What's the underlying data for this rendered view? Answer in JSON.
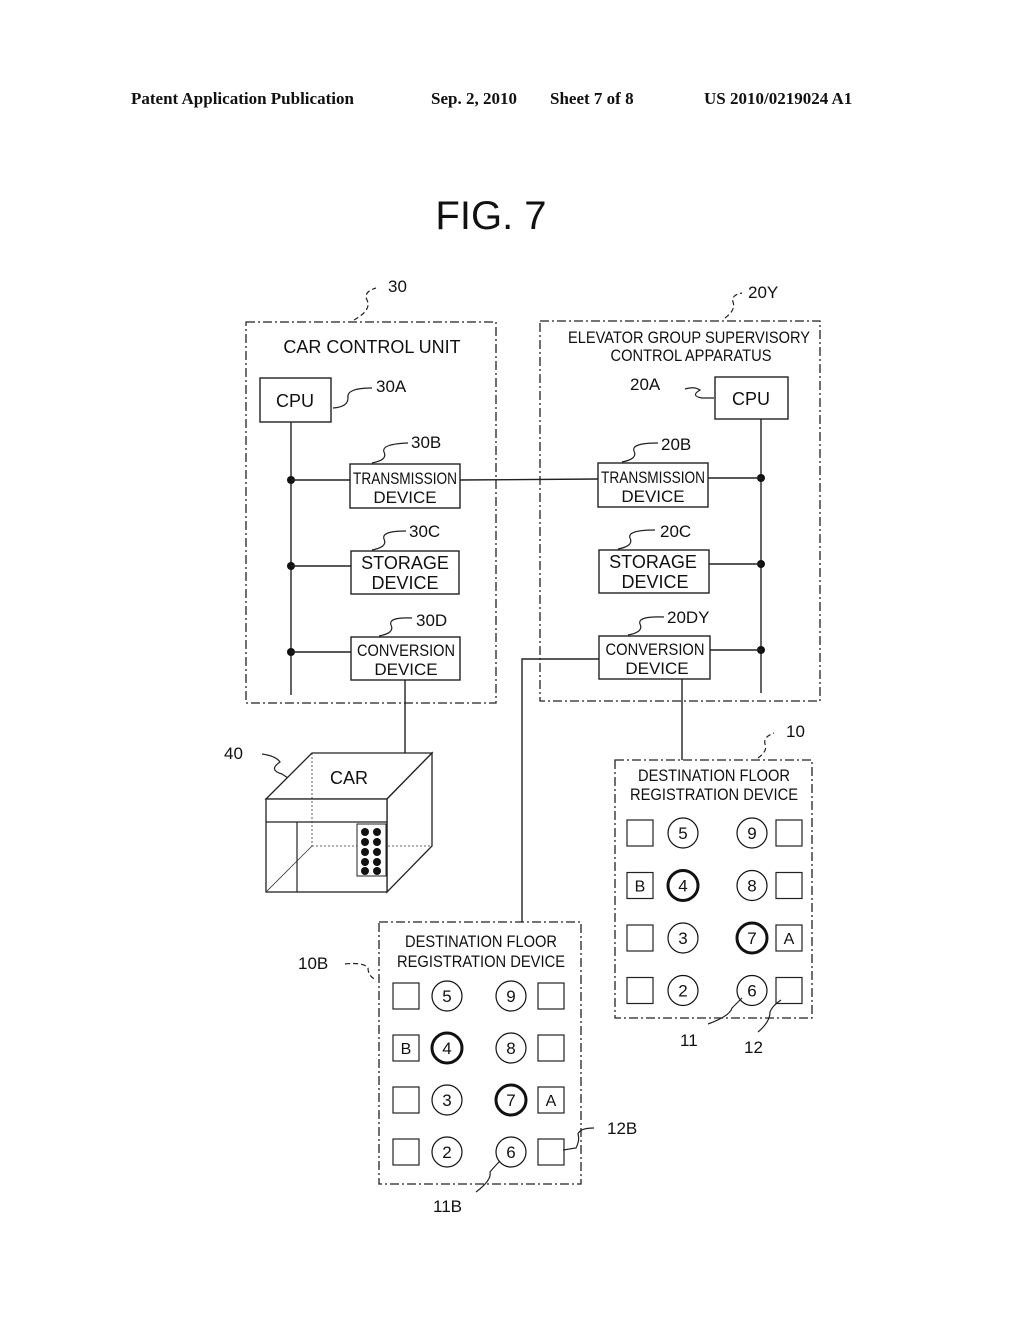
{
  "header": {
    "publication": "Patent Application Publication",
    "date": "Sep. 2, 2010",
    "sheet": "Sheet 7 of 8",
    "patent_number": "US 2010/0219024 A1"
  },
  "figure": {
    "title": "FIG. 7"
  },
  "car_control_unit": {
    "ref": "30",
    "title": "CAR CONTROL UNIT",
    "cpu": {
      "ref": "30A",
      "label": "CPU"
    },
    "transmission": {
      "ref": "30B",
      "line1": "TRANSMISSION",
      "line2": "DEVICE"
    },
    "storage": {
      "ref": "30C",
      "line1": "STORAGE",
      "line2": "DEVICE"
    },
    "conversion": {
      "ref": "30D",
      "line1": "CONVERSION",
      "line2": "DEVICE"
    }
  },
  "supervisory": {
    "ref": "20Y",
    "title_line1": "ELEVATOR GROUP SUPERVISORY",
    "title_line2": "CONTROL APPARATUS",
    "cpu": {
      "ref": "20A",
      "label": "CPU"
    },
    "transmission": {
      "ref": "20B",
      "line1": "TRANSMISSION",
      "line2": "DEVICE"
    },
    "storage": {
      "ref": "20C",
      "line1": "STORAGE",
      "line2": "DEVICE"
    },
    "conversion": {
      "ref": "20DY",
      "line1": "CONVERSION",
      "line2": "DEVICE"
    }
  },
  "car": {
    "ref": "40",
    "label": "CAR"
  },
  "dest_device_10": {
    "ref": "10",
    "title_line1": "DESTINATION FLOOR",
    "title_line2": "REGISTRATION DEVICE",
    "button_ref": "11",
    "display_ref": "12",
    "rows": [
      {
        "left_display": "",
        "left_button": "5",
        "left_bold": false,
        "right_button": "9",
        "right_bold": false,
        "right_display": ""
      },
      {
        "left_display": "B",
        "left_button": "4",
        "left_bold": true,
        "right_button": "8",
        "right_bold": false,
        "right_display": ""
      },
      {
        "left_display": "",
        "left_button": "3",
        "left_bold": false,
        "right_button": "7",
        "right_bold": true,
        "right_display": "A"
      },
      {
        "left_display": "",
        "left_button": "2",
        "left_bold": false,
        "right_button": "6",
        "right_bold": false,
        "right_display": ""
      }
    ]
  },
  "dest_device_10B": {
    "ref": "10B",
    "title_line1": "DESTINATION FLOOR",
    "title_line2": "REGISTRATION DEVICE",
    "button_ref": "11B",
    "display_ref": "12B",
    "rows": [
      {
        "left_display": "",
        "left_button": "5",
        "left_bold": false,
        "right_button": "9",
        "right_bold": false,
        "right_display": ""
      },
      {
        "left_display": "B",
        "left_button": "4",
        "left_bold": true,
        "right_button": "8",
        "right_bold": false,
        "right_display": ""
      },
      {
        "left_display": "",
        "left_button": "3",
        "left_bold": false,
        "right_button": "7",
        "right_bold": true,
        "right_display": "A"
      },
      {
        "left_display": "",
        "left_button": "2",
        "left_bold": false,
        "right_button": "6",
        "right_bold": false,
        "right_display": ""
      }
    ]
  }
}
